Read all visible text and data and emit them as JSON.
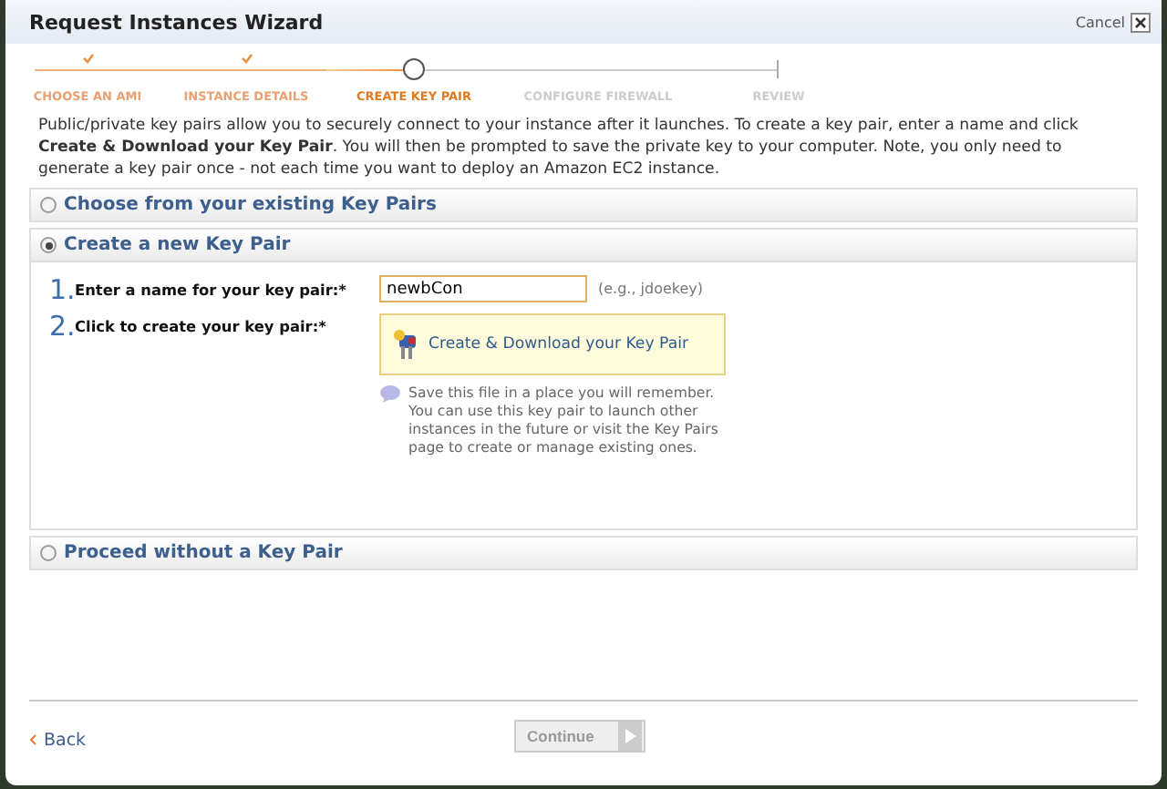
{
  "window": {
    "title": "Request Instances Wizard",
    "cancel": "Cancel"
  },
  "steps": [
    {
      "label": "CHOOSE AN AMI",
      "completed": true,
      "selected": false
    },
    {
      "label": "INSTANCE DETAILS",
      "completed": true,
      "selected": false
    },
    {
      "label": "CREATE KEY PAIR",
      "completed": false,
      "selected": true
    },
    {
      "label": "CONFIGURE FIREWALL",
      "completed": false,
      "selected": false
    },
    {
      "label": "REVIEW",
      "completed": false,
      "selected": false
    }
  ],
  "intro": "Public/private key pairs allow you to securely connect to your instance after it launches. To create a key pair, enter a name and click **Create & Download your Key Pair**. You will then be prompted to save the private key to your computer. Note, you only need to generate a key pair once - not each time you want to deploy an Amazon EC2 instance.",
  "options": [
    {
      "label": "Choose from your existing Key Pairs",
      "selected": false
    },
    {
      "label": "Create a new Key Pair",
      "selected": true,
      "form": {
        "name_step": {
          "number": "1.",
          "label": "Enter a name for your key pair:*",
          "value": "newbCon",
          "hint": "(e.g., jdoekey)"
        },
        "create_step": {
          "number": "2.",
          "label": "Click to create your key pair:*",
          "button": "Create & Download your Key Pair",
          "note": "Save this file in a place you will remember. You can use this key pair to launch other instances in the future or visit the Key Pairs page to create or manage existing ones."
        }
      }
    },
    {
      "label": "Proceed without a Key Pair",
      "selected": false
    }
  ],
  "footer": {
    "back": "Back",
    "continue": {
      "label": "Continue",
      "disabled": true
    }
  }
}
